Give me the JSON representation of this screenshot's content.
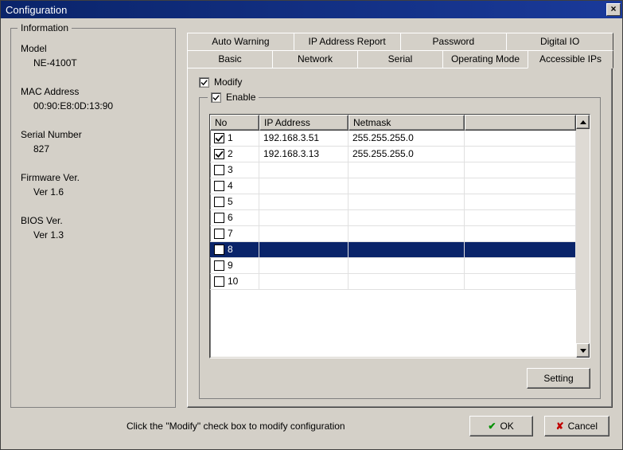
{
  "window": {
    "title": "Configuration"
  },
  "info": {
    "legend": "Information",
    "model_label": "Model",
    "model_value": "NE-4100T",
    "mac_label": "MAC Address",
    "mac_value": "00:90:E8:0D:13:90",
    "serial_label": "Serial Number",
    "serial_value": "827",
    "firmware_label": "Firmware Ver.",
    "firmware_value": "Ver 1.6",
    "bios_label": "BIOS Ver.",
    "bios_value": "Ver 1.3"
  },
  "tabs": {
    "row1": [
      "Auto Warning",
      "IP Address Report",
      "Password",
      "Digital IO"
    ],
    "row2": [
      "Basic",
      "Network",
      "Serial",
      "Operating Mode",
      "Accessible IPs"
    ],
    "active": "Accessible IPs"
  },
  "panel": {
    "modify_label": "Modify",
    "modify_checked": true,
    "enable_label": "Enable",
    "enable_checked": true,
    "columns": {
      "no": "No",
      "ip": "IP Address",
      "mask": "Netmask"
    },
    "rows": [
      {
        "no": "1",
        "checked": true,
        "ip": "192.168.3.51",
        "mask": "255.255.255.0",
        "selected": false
      },
      {
        "no": "2",
        "checked": true,
        "ip": "192.168.3.13",
        "mask": "255.255.255.0",
        "selected": false
      },
      {
        "no": "3",
        "checked": false,
        "ip": "",
        "mask": "",
        "selected": false
      },
      {
        "no": "4",
        "checked": false,
        "ip": "",
        "mask": "",
        "selected": false
      },
      {
        "no": "5",
        "checked": false,
        "ip": "",
        "mask": "",
        "selected": false
      },
      {
        "no": "6",
        "checked": false,
        "ip": "",
        "mask": "",
        "selected": false
      },
      {
        "no": "7",
        "checked": false,
        "ip": "",
        "mask": "",
        "selected": false
      },
      {
        "no": "8",
        "checked": false,
        "ip": "",
        "mask": "",
        "selected": true
      },
      {
        "no": "9",
        "checked": false,
        "ip": "",
        "mask": "",
        "selected": false
      },
      {
        "no": "10",
        "checked": false,
        "ip": "",
        "mask": "",
        "selected": false
      }
    ],
    "setting_button": "Setting"
  },
  "footer": {
    "hint": "Click the \"Modify\" check box to modify configuration",
    "ok": "OK",
    "cancel": "Cancel"
  }
}
